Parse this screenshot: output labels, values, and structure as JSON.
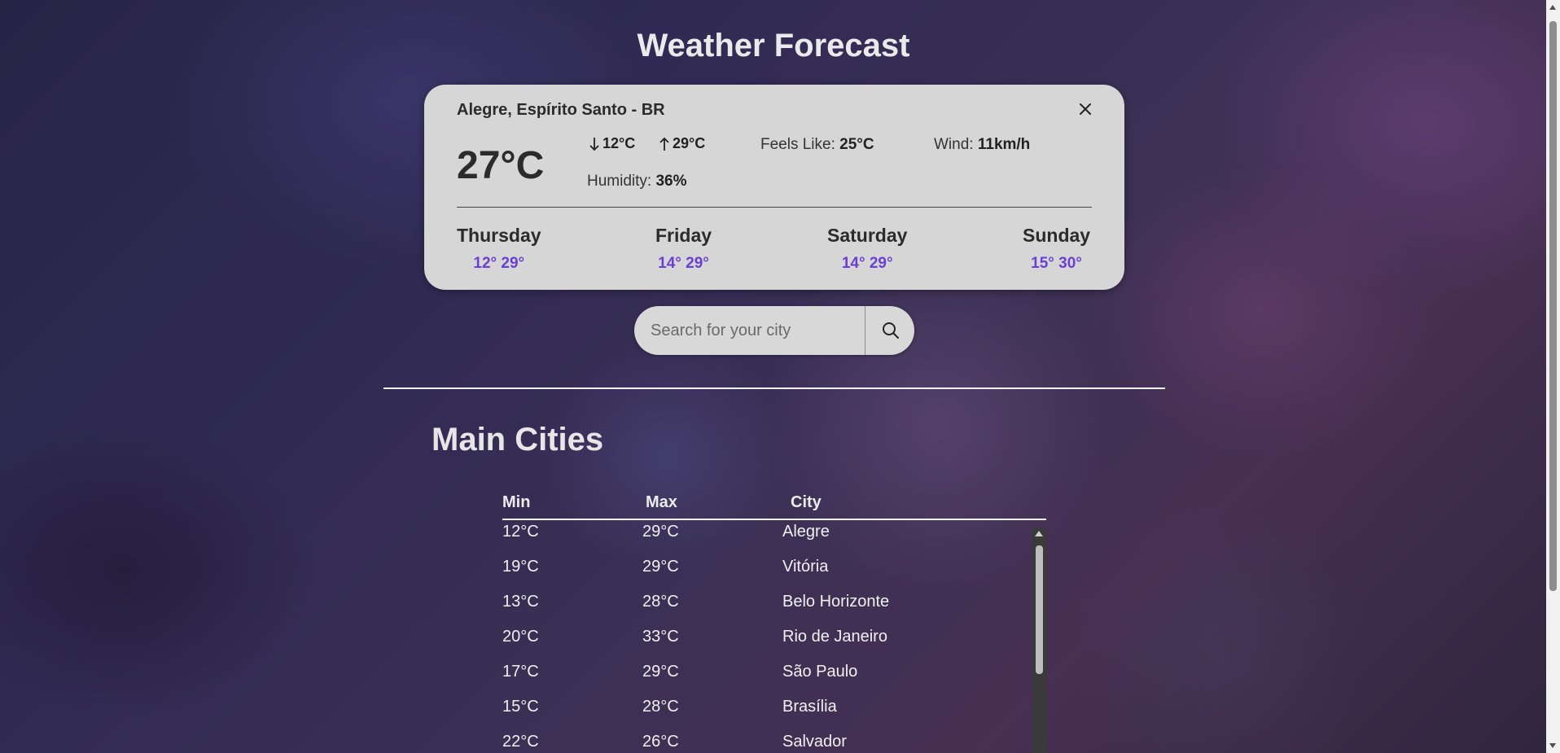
{
  "page": {
    "title": "Weather Forecast"
  },
  "current": {
    "location": "Alegre, Espírito Santo - BR",
    "temperature": "27°C",
    "min": "12°C",
    "max": "29°C",
    "feels_like_label": "Feels Like:",
    "feels_like": "25°C",
    "wind_label": "Wind:",
    "wind": "11km/h",
    "humidity_label": "Humidity:",
    "humidity": "36%"
  },
  "forecast": [
    {
      "day": "Thursday",
      "temps": "12° 29°"
    },
    {
      "day": "Friday",
      "temps": "14° 29°"
    },
    {
      "day": "Saturday",
      "temps": "14° 29°"
    },
    {
      "day": "Sunday",
      "temps": "15° 30°"
    }
  ],
  "search": {
    "placeholder": "Search for your city",
    "value": ""
  },
  "cities": {
    "title": "Main Cities",
    "headers": [
      "Min",
      "Max",
      "City"
    ],
    "rows": [
      {
        "min": "12°C",
        "max": "29°C",
        "city": "Alegre"
      },
      {
        "min": "19°C",
        "max": "29°C",
        "city": "Vitória"
      },
      {
        "min": "13°C",
        "max": "28°C",
        "city": "Belo Horizonte"
      },
      {
        "min": "20°C",
        "max": "33°C",
        "city": "Rio de Janeiro"
      },
      {
        "min": "17°C",
        "max": "29°C",
        "city": "São Paulo"
      },
      {
        "min": "15°C",
        "max": "28°C",
        "city": "Brasília"
      },
      {
        "min": "22°C",
        "max": "26°C",
        "city": "Salvador"
      }
    ]
  },
  "colors": {
    "accent": "#6a3fd4",
    "card": "#d6d6d6"
  },
  "icons": [
    "close-icon",
    "arrow-down-icon",
    "arrow-up-icon",
    "search-icon"
  ]
}
